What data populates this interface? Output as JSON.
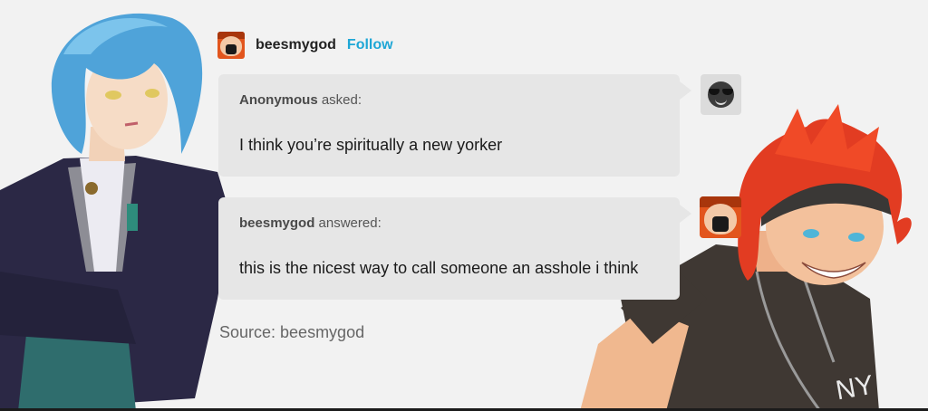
{
  "post": {
    "blog_name": "beesmygod",
    "follow_label": "Follow",
    "ask": {
      "asker": "Anonymous",
      "verb": "asked:",
      "text": "I think you’re spiritually a new yorker"
    },
    "answer": {
      "answerer": "beesmygod",
      "verb": "answered:",
      "text": "this is the nicest way to call someone an asshole i think"
    },
    "source_label": "Source: beesmygod"
  },
  "colors": {
    "background": "#f2f2f2",
    "bubble": "#e6e6e6",
    "follow": "#1fa7d6",
    "avatar": "#e2551d"
  },
  "icons": [
    "beesmygod-avatar",
    "anonymous-sunglasses-avatar"
  ],
  "decorations": {
    "right_character_shirt_text": "NY"
  }
}
